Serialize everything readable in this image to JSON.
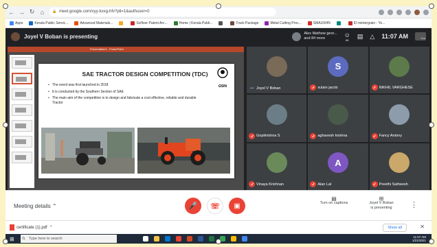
{
  "browser": {
    "url": "meet.google.com/xyy-kxxg-hfv?pli=1&authuser=0",
    "bookmarks": [
      {
        "label": "Apps",
        "color": "#4285f4"
      },
      {
        "label": "Kerala Public Servic...",
        "color": "#1565c0"
      },
      {
        "label": "Advanced Materials...",
        "color": "#e65100"
      },
      {
        "label": "",
        "color": "#f9a825"
      },
      {
        "label": "Scifloor Patent Arc...",
        "color": "#c62828"
      },
      {
        "label": "Home | Kerala Publi...",
        "color": "#2e7d32"
      },
      {
        "label": "",
        "color": "#555555"
      },
      {
        "label": "Track Package",
        "color": "#6d4c41"
      },
      {
        "label": "Metal Cutting Proc...",
        "color": "#8e24aa"
      },
      {
        "label": "SMAUSHN",
        "color": "#d32f2f"
      },
      {
        "label": "",
        "color": "#00897b"
      },
      {
        "label": "ID mintergrain - Yo...",
        "color": "#c62828"
      }
    ]
  },
  "meet": {
    "presenting_text": "Joyel V Boban is presenting",
    "others_text": [
      "Alex Mathew geor...",
      "and 84 more"
    ],
    "time": "11:07 AM",
    "you_label": "You",
    "people_count": "86"
  },
  "slide": {
    "app_bar_text": "Presentation1 - PowerPoint",
    "title": "SAE TRACTOR DESIGN COMPETITION (TDC)",
    "logo_text": "ΩSIN",
    "bullets": [
      "The event was first launched in 2018",
      "It is conducted by the Southern Section of SAE",
      "The main aim of the competition is to design and fabricate a cost effective, reliable and durable Tractor"
    ]
  },
  "participants": [
    {
      "name": "Joyel V Boban",
      "initial": "",
      "color": "#7a6a58",
      "muted": false
    },
    {
      "name": "sulain jacob",
      "initial": "S",
      "color": "#5c6bc0",
      "muted": true
    },
    {
      "name": "NIKHIL VARGHESE",
      "initial": "",
      "color": "#5d7a4a",
      "muted": true
    },
    {
      "name": "Gopikrishna S",
      "initial": "",
      "color": "#6b7d86",
      "muted": true
    },
    {
      "name": "aghavesh krishna",
      "initial": "",
      "color": "#4a5a4a",
      "muted": true
    },
    {
      "name": "Fancy Antony",
      "initial": "",
      "color": "#8d9cab",
      "muted": true
    },
    {
      "name": "Vinaya Krishnan",
      "initial": "",
      "color": "#6a8a5a",
      "muted": true
    },
    {
      "name": "Alan Lal",
      "initial": "A",
      "color": "#7e57c2",
      "muted": true
    },
    {
      "name": "Preethi Satheesh",
      "initial": "",
      "color": "#c9a86a",
      "muted": true
    }
  ],
  "controls": {
    "meeting_details": "Meeting details",
    "captions_label": "Turn on captions",
    "presenting_label": [
      "Joyel V Boban",
      "is presenting"
    ]
  },
  "downloads": {
    "file": "certificate (1).pdf",
    "show_all": "Show all"
  },
  "taskbar": {
    "search_placeholder": "Type here to search",
    "time": "11:07 AM",
    "date": "1/21/2021"
  }
}
